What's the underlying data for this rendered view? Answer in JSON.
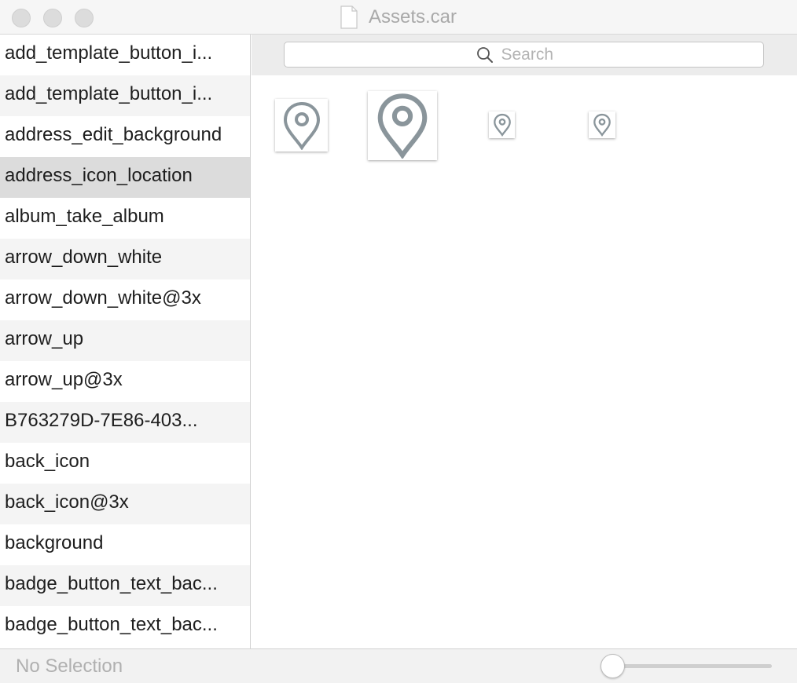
{
  "window": {
    "title": "Assets.car"
  },
  "sidebar": {
    "items": [
      {
        "label": "add_template_button_i..."
      },
      {
        "label": "add_template_button_i..."
      },
      {
        "label": "address_edit_background"
      },
      {
        "label": "address_icon_location"
      },
      {
        "label": "album_take_album"
      },
      {
        "label": "arrow_down_white"
      },
      {
        "label": "arrow_down_white@3x"
      },
      {
        "label": "arrow_up"
      },
      {
        "label": "arrow_up@3x"
      },
      {
        "label": "B763279D-7E86-403..."
      },
      {
        "label": "back_icon"
      },
      {
        "label": "back_icon@3x"
      },
      {
        "label": "background"
      },
      {
        "label": "badge_button_text_bac..."
      },
      {
        "label": "badge_button_text_bac..."
      }
    ],
    "selected_index": 3
  },
  "search": {
    "placeholder": "Search",
    "value": ""
  },
  "preview": {
    "icon": "location-pin-icon",
    "icon_color": "#8a959b"
  },
  "status": {
    "text": "No Selection"
  },
  "zoom_slider": {
    "value": 0
  }
}
